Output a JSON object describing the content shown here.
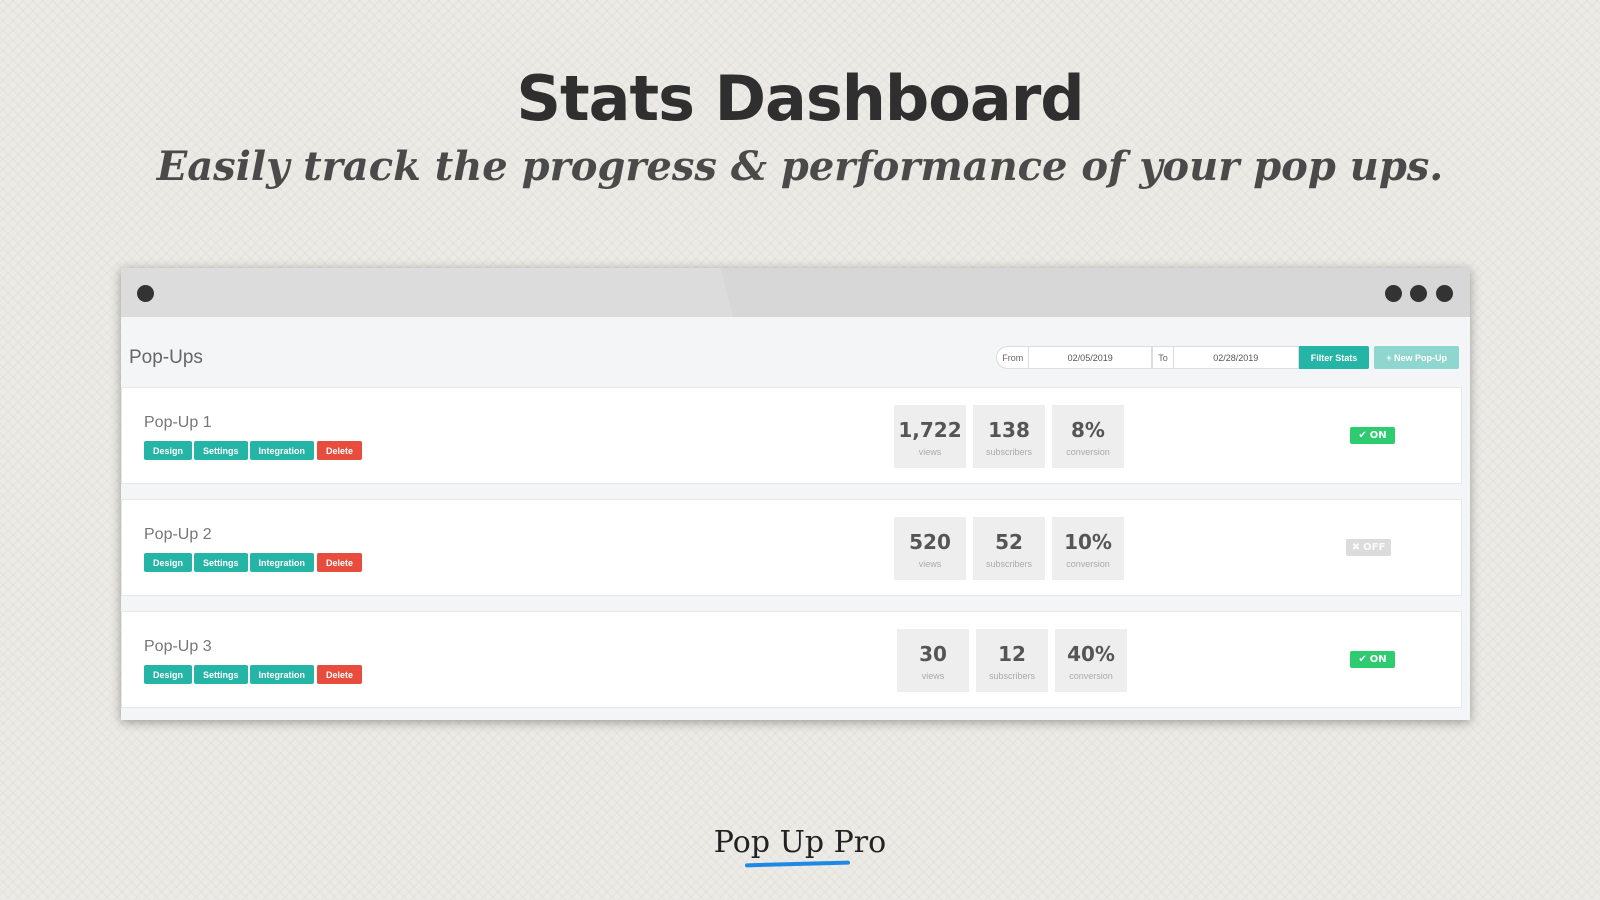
{
  "hero": {
    "title": "Stats Dashboard",
    "subtitle": "Easily track the progress & performance of your pop ups."
  },
  "dashboard": {
    "title": "Pop-Ups",
    "filters": {
      "from_label": "From",
      "from_value": "02/05/2019",
      "to_label": "To",
      "to_value": "02/28/2019",
      "filter_button": "Filter Stats",
      "new_button": "+ New Pop-Up"
    },
    "popups": [
      {
        "name": "Pop-Up 1",
        "actions": [
          "Design",
          "Settings",
          "Integration",
          "Delete"
        ],
        "stats": [
          {
            "value": "1,722",
            "label": "views"
          },
          {
            "value": "138",
            "label": "subscribers"
          },
          {
            "value": "8%",
            "label": "conversion"
          }
        ],
        "status": "ON",
        "status_icon": "✔"
      },
      {
        "name": "Pop-Up 2",
        "actions": [
          "Design",
          "Settings",
          "Integration",
          "Delete"
        ],
        "stats": [
          {
            "value": "520",
            "label": "views"
          },
          {
            "value": "52",
            "label": "subscribers"
          },
          {
            "value": "10%",
            "label": "conversion"
          }
        ],
        "status": "OFF",
        "status_icon": "✖"
      },
      {
        "name": "Pop-Up 3",
        "actions": [
          "Design",
          "Settings",
          "Integration",
          "Delete"
        ],
        "stats": [
          {
            "value": "30",
            "label": "views"
          },
          {
            "value": "12",
            "label": "subscribers"
          },
          {
            "value": "40%",
            "label": "conversion"
          }
        ],
        "status": "ON",
        "status_icon": "✔"
      }
    ]
  },
  "brand": {
    "name": "Pop Up Pro"
  },
  "colors": {
    "accent": "#25b5a6",
    "danger": "#e74c3c",
    "on": "#2ecc71",
    "off": "#dcdcdc",
    "brand_underline": "#1e88e5"
  }
}
